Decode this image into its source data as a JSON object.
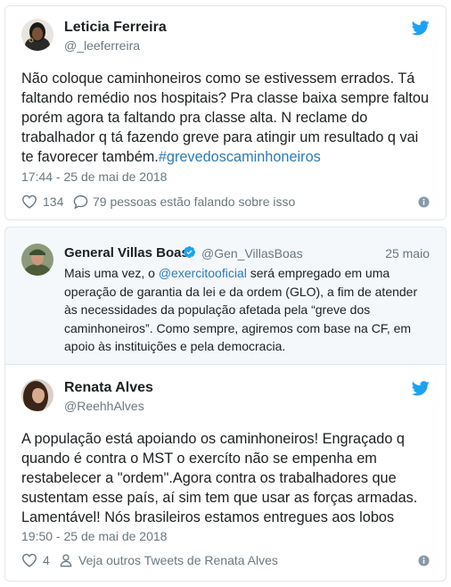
{
  "tweet1": {
    "name": "Leticia Ferreira",
    "handle": "@_leeferreira",
    "text": "Não coloque caminhoneiros como se estivessem errados. Tá faltando remédio nos hospitais? Pra classe baixa sempre faltou porém agora ta faltando pra classe alta. N reclame do trabalhador q tá fazendo greve para atingir um resultado q vai te favorecer também.",
    "hashtag": "#grevedoscaminhoneiros",
    "date": "17:44 - 25 de mai de 2018",
    "likes": "134",
    "conversation": "79 pessoas estão falando sobre isso",
    "icons": [
      "twitter-bird-icon",
      "heart-icon",
      "speech-bubble-icon",
      "info-icon"
    ]
  },
  "quoted": {
    "name": "General Villas Boas",
    "handle": "@Gen_VillasBoas",
    "date": "25 maio",
    "text_before": "Mais uma vez, o ",
    "mention": "@exercitooficial",
    "text_after": "  será empregado em uma operação de garantia da lei e da ordem (GLO), a fim de atender às necessidades da população afetada pela “greve dos caminhoneiros”. Como sempre, agiremos com base na CF, em apoio às instituições e pela democracia.",
    "icons": [
      "verified-badge-icon"
    ]
  },
  "tweet2": {
    "name": "Renata Alves",
    "handle": "@ReehhAlves",
    "text": "A população está apoiando os caminhoneiros! Engraçado q quando é contra o MST o exercíto não se empenha em restabelecer a \"ordem\".Agora contra os trabalhadores que sustentam esse país, aí sim tem que usar as forças armadas. Lamentável! Nós brasileiros estamos entregues aos lobos",
    "date": "19:50 - 25 de mai de 2018",
    "likes": "4",
    "profile_link": "Veja outros Tweets de Renata Alves",
    "icons": [
      "twitter-bird-icon",
      "heart-icon",
      "person-icon",
      "info-icon"
    ]
  },
  "colors": {
    "twitter_blue": "#1da1f2",
    "link_blue": "#2b7bb9",
    "secondary_text": "#697882",
    "border": "#e1e8ed",
    "quoted_bg": "#f5f8fa"
  }
}
